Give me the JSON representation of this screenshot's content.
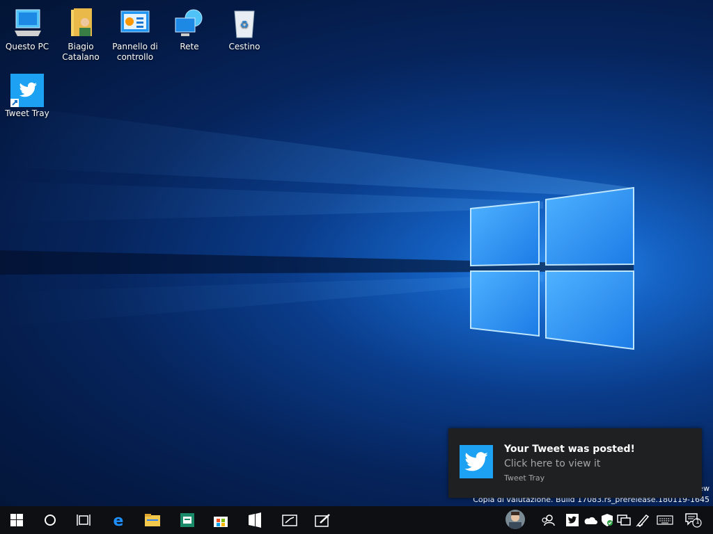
{
  "desktop": {
    "icons": [
      {
        "label": "Questo PC",
        "icon": "computer-icon"
      },
      {
        "label": "Biagio Catalano",
        "icon": "user-folder-icon"
      },
      {
        "label": "Pannello di controllo",
        "icon": "control-panel-icon"
      },
      {
        "label": "Rete",
        "icon": "network-icon"
      },
      {
        "label": "Cestino",
        "icon": "recycle-bin-icon"
      },
      {
        "label": "Tweet Tray",
        "icon": "twitter-shortcut-icon"
      }
    ],
    "watermark_top": "ew",
    "watermark": "Copia di valutazione. Build 17083.rs_prerelease.180119-1645"
  },
  "notification": {
    "title": "Your Tweet was posted!",
    "body": "Click here to view it",
    "app": "Tweet Tray",
    "icon": "twitter-icon",
    "accent": "#1da1f2"
  },
  "taskbar": {
    "buttons": [
      "start-icon",
      "cortana-icon",
      "task-view-icon",
      "edge-icon",
      "file-explorer-icon",
      "printer-app-icon",
      "store-icon",
      "app-icon",
      "whiteboard-icon",
      "sketch-icon"
    ],
    "tray": [
      "avatar",
      "people-icon",
      "twitter-tray-icon",
      "onedrive-icon",
      "defender-icon",
      "network-icon",
      "pen-icon",
      "keyboard-icon",
      "action-center-icon"
    ],
    "notification_count": "1"
  }
}
